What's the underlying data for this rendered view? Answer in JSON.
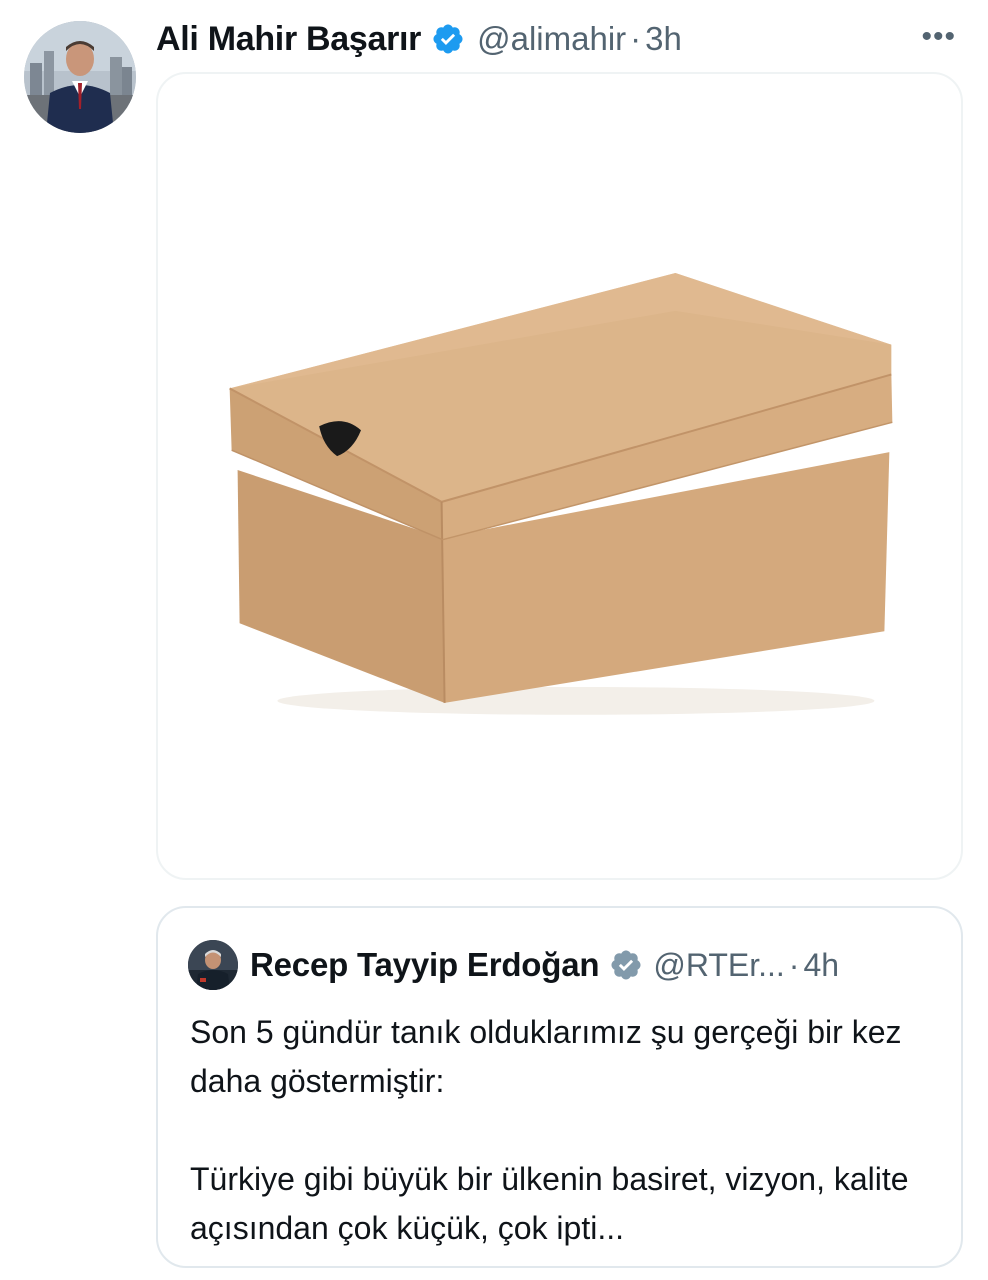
{
  "tweet": {
    "author_name": "Ali Mahir Başarır",
    "author_handle": "@alimahir",
    "separator": "·",
    "time": "3h",
    "more_label": "•••",
    "media_icon": "shoebox-image"
  },
  "quoted_tweet": {
    "author_name": "Recep Tayyip Erdoğan",
    "author_handle": "@RTEr...",
    "separator": "·",
    "time": "4h",
    "paragraphs": [
      "Son 5 gündür tanık olduklarımız şu gerçeği bir kez daha göstermiştir:",
      "Türkiye gibi büyük bir ülkenin basiret, vizyon, kalite açısından çok küçük, çok ipti..."
    ]
  },
  "colors": {
    "verified_blue": "#1d9bf0",
    "verified_gray": "#829aab",
    "secondary_text": "#536471",
    "box_main": "#d4a87a"
  }
}
